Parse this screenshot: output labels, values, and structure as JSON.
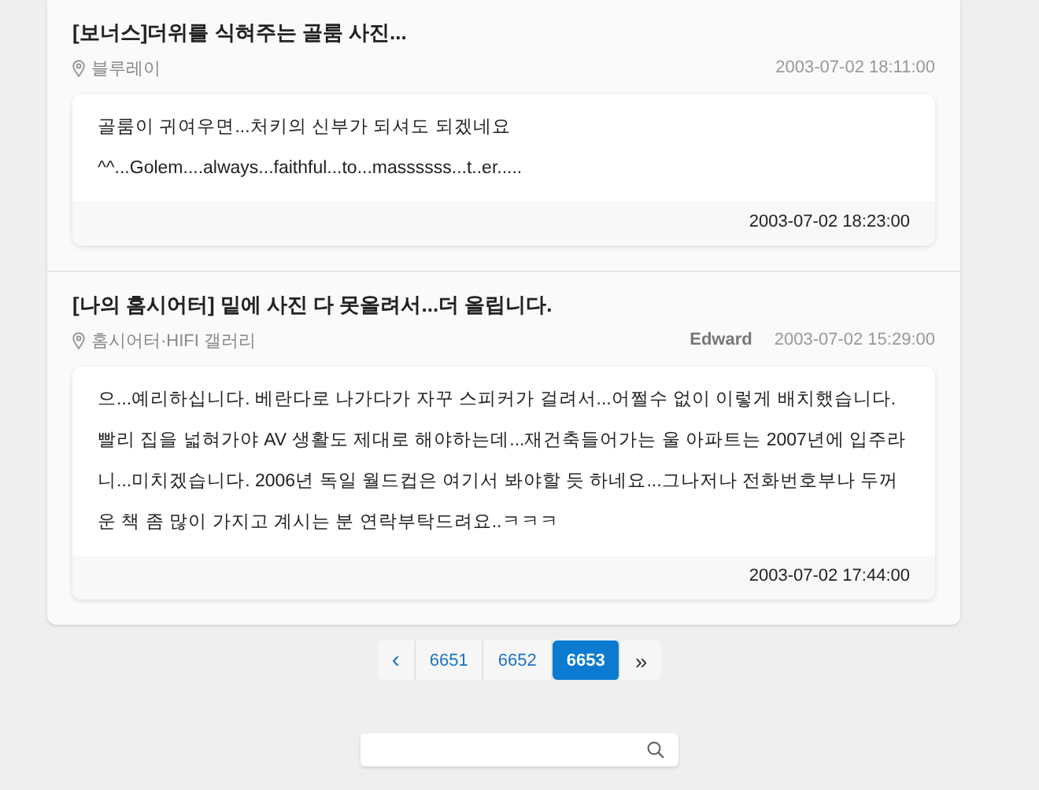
{
  "posts": [
    {
      "title": "[보너스]더위를 식혀주는 골룸 사진...",
      "board": "블루레이",
      "date": "2003-07-02 18:11:00",
      "replies": [
        {
          "text": "골룸이 귀여우면...처키의 신부가 되셔도 되겠네요 ^^...Golem....always...faithful...to...massssss...t..er.....",
          "date": "2003-07-02 18:23:00"
        }
      ]
    },
    {
      "title": "[나의 홈시어터] 밑에 사진 다 못올려서...더 올립니다.",
      "board": "홈시어터·HIFI 갤러리",
      "author": "Edward",
      "date": "2003-07-02 15:29:00",
      "replies": [
        {
          "text": "으...예리하십니다. 베란다로 나가다가 자꾸 스피커가 걸려서...어쩔수 없이 이렇게 배치했습니다. 빨리 집을 넓혀가야 AV 생활도 제대로 해야하는데...재건축들어가는 울 아파트는 2007년에 입주라니...미치겠습니다. 2006년 독일 월드컵은 여기서 봐야할 듯 하네요...그나저나 전화번호부나 두꺼운 책 좀 많이 가지고 계시는 분 연락부탁드려요..ㅋㅋㅋ",
          "date": "2003-07-02 17:44:00"
        }
      ]
    }
  ],
  "pagination": [
    {
      "kind": "prev",
      "label": "‹",
      "selected": false
    },
    {
      "kind": "page",
      "label": "6651",
      "selected": false
    },
    {
      "kind": "page",
      "label": "6652",
      "selected": false
    },
    {
      "kind": "page",
      "label": "6653",
      "selected": true
    },
    {
      "kind": "last",
      "label": "»",
      "selected": false
    }
  ]
}
